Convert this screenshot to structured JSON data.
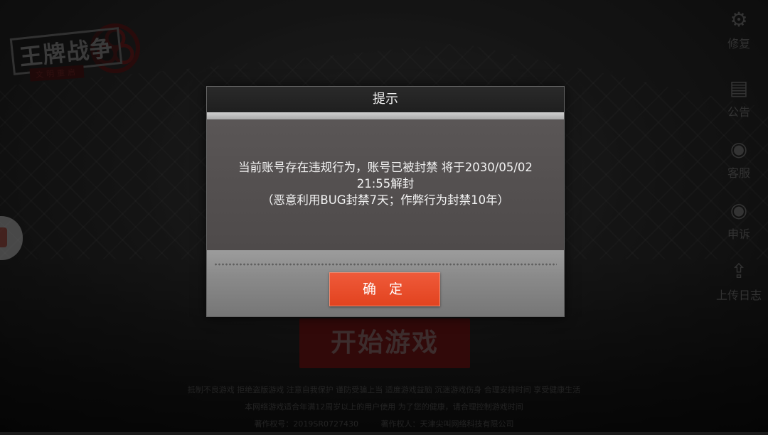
{
  "logo": {
    "title": "王牌战争",
    "subtitle": "文明重启"
  },
  "right_menu": [
    {
      "icon": "wrench-gear-icon",
      "label": "修复"
    },
    {
      "icon": "notice-icon",
      "label": "公告"
    },
    {
      "icon": "headset-icon",
      "label": "客服"
    },
    {
      "icon": "headset-icon",
      "label": "申诉"
    },
    {
      "icon": "upload-icon",
      "label": "上传日志"
    }
  ],
  "start_button": {
    "label": "开始游戏"
  },
  "dialog": {
    "title": "提示",
    "message_line1": "当前账号存在违规行为，账号已被封禁 将于2030/05/02",
    "message_line2": "21:55解封",
    "message_line3": "（恶意利用BUG封禁7天；作弊行为封禁10年）",
    "confirm_label": "确 定"
  },
  "footer": {
    "line1": "抵制不良游戏 拒绝盗版游戏 注意自我保护 谨防受骗上当 适度游戏益脑 沉迷游戏伤身 合理安排时间 享受健康生活",
    "line2": "本网络游戏适合年满12周岁以上的用户使用    为了您的健康，请合理控制游戏时间",
    "copyright_no": "著作权号：2019SR0727430",
    "copyright_owner": "著作权人：天津尖叫网络科技有限公司"
  },
  "colors": {
    "confirm_button": "#e2431f",
    "start_button": "#5a1212"
  }
}
